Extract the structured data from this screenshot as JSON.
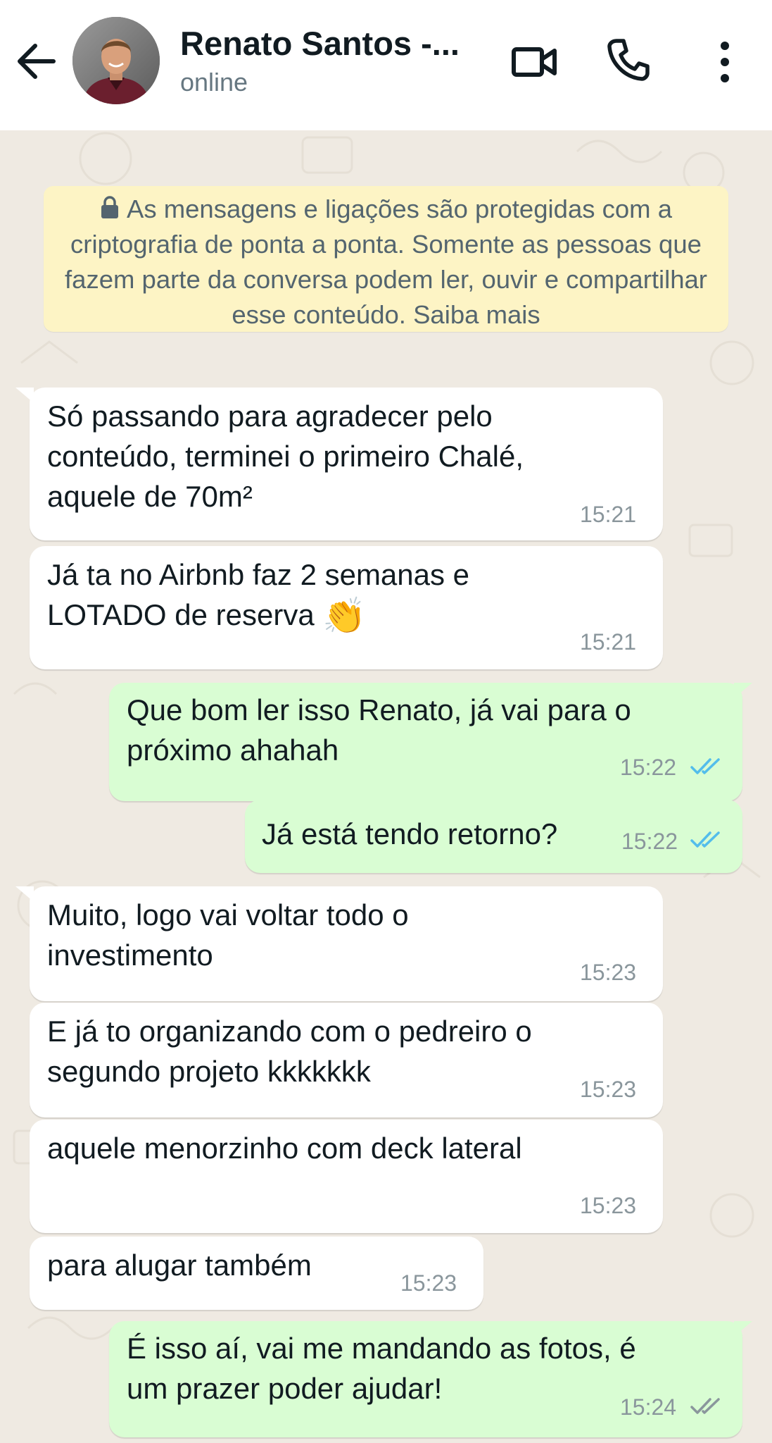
{
  "header": {
    "contact_name": "Renato Santos -...",
    "status": "online"
  },
  "encryption_notice": {
    "text": "As mensagens e ligações são protegidas com a criptografia de ponta a ponta. Somente as pessoas que fazem parte da conversa podem ler, ouvir e compartilhar esse conteúdo. Saiba mais"
  },
  "messages": [
    {
      "direction": "incoming",
      "text": "Só passando para agradecer pelo\nconteúdo, terminei o primeiro Chalé,\naquele de 70m²",
      "time": "15:21"
    },
    {
      "direction": "incoming",
      "text": "Já ta no Airbnb faz 2 semanas e\nLOTADO de reserva",
      "emoji": "👏",
      "time": "15:21"
    },
    {
      "direction": "outgoing",
      "text": "Que bom ler isso Renato, já vai para o\npróximo ahahah",
      "time": "15:22",
      "status": "read"
    },
    {
      "direction": "outgoing",
      "text": "Já está tendo retorno?",
      "time": "15:22",
      "status": "read"
    },
    {
      "direction": "incoming",
      "text": "Muito, logo vai voltar todo o\ninvestimento",
      "time": "15:23"
    },
    {
      "direction": "incoming",
      "text": "E já to organizando com o pedreiro o\nsegundo projeto kkkkkkk",
      "time": "15:23"
    },
    {
      "direction": "incoming",
      "text": "aquele menorzinho com deck lateral",
      "time": "15:23"
    },
    {
      "direction": "incoming",
      "text": "para alugar também",
      "time": "15:23"
    },
    {
      "direction": "outgoing",
      "text": "É isso aí, vai me mandando as fotos, é\num prazer poder ajudar!",
      "time": "15:24",
      "status": "delivered"
    }
  ],
  "colors": {
    "chat_background": "#efeae2",
    "incoming_bubble": "#ffffff",
    "outgoing_bubble": "#d9fdd3",
    "read_ticks": "#53bdeb",
    "delivered_ticks": "#8a969c",
    "notice_background": "#fdf4c5"
  },
  "icons": {
    "back": "arrow-left-icon",
    "video": "video-camera-icon",
    "call": "phone-icon",
    "menu": "more-vertical-icon",
    "lock": "lock-icon",
    "read": "double-check-icon"
  }
}
